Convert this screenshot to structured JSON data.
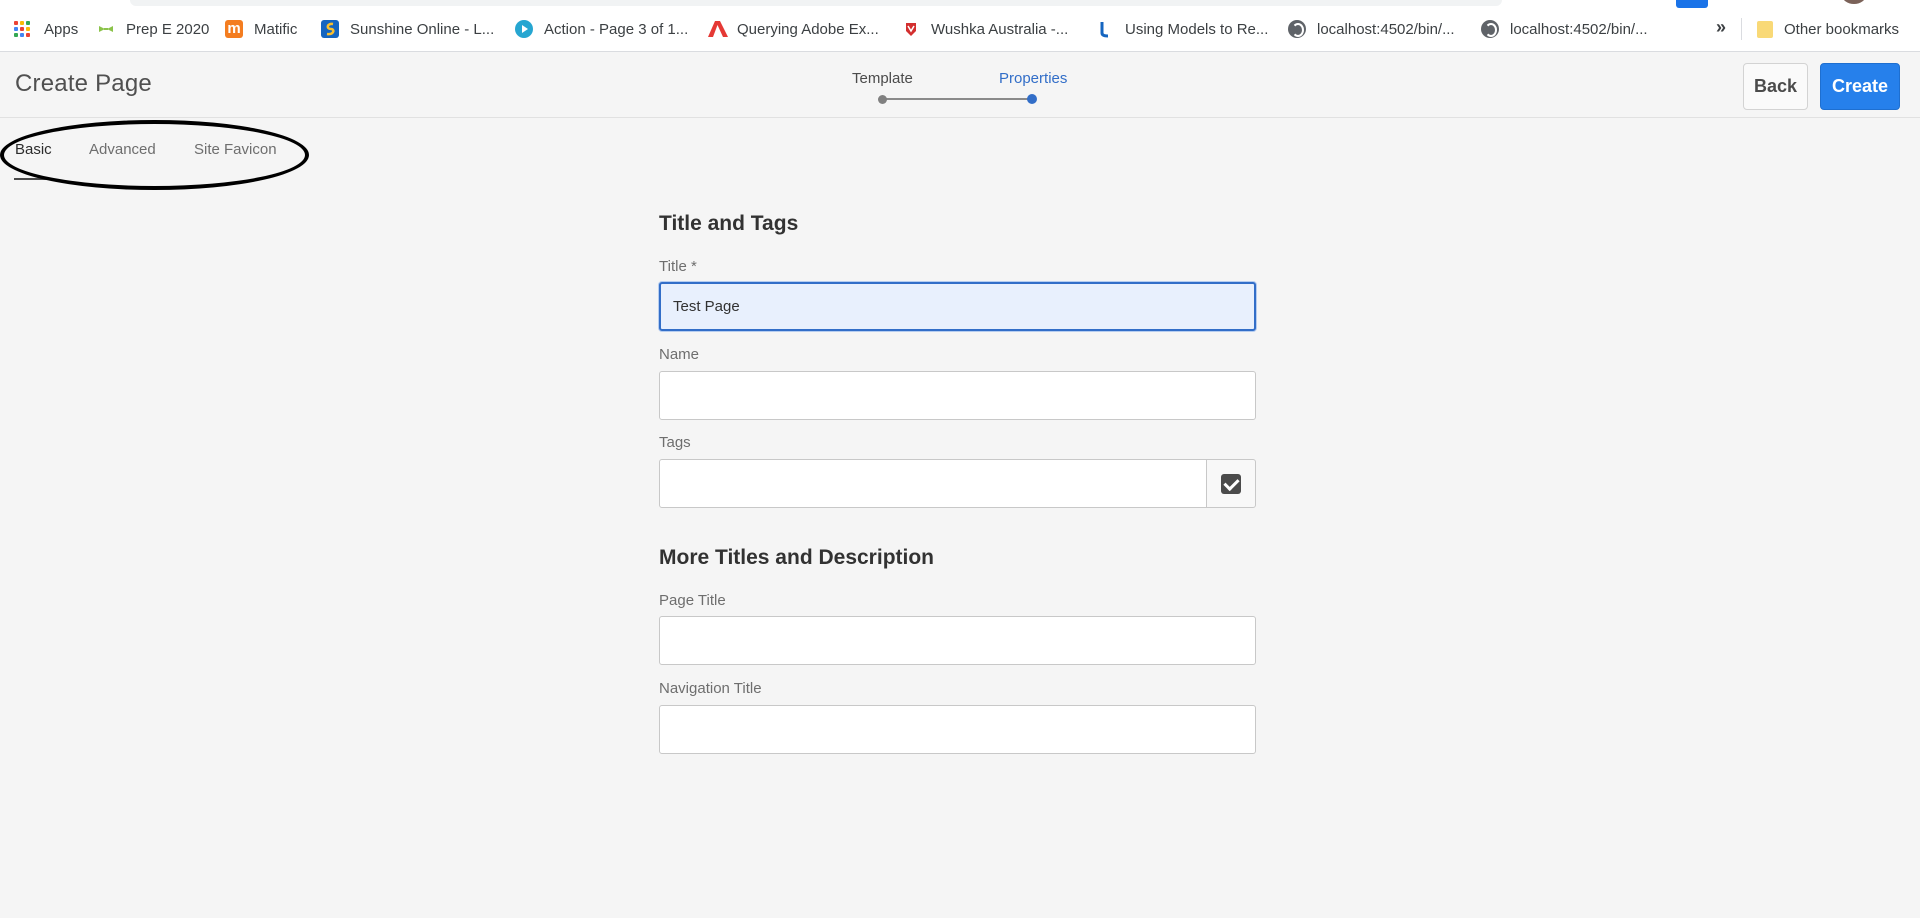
{
  "bookmarks": {
    "items": [
      {
        "label": "Apps",
        "icon": "apps-grid-icon"
      },
      {
        "label": "Prep E 2020",
        "icon": "prep-bookmark-icon",
        "color": "#8bc34a"
      },
      {
        "label": "Matific",
        "icon": "matific-icon",
        "color": "#f47d20"
      },
      {
        "label": "Sunshine Online - L...",
        "icon": "sunshine-online-icon",
        "color": "#1565c0"
      },
      {
        "label": "Action - Page 3 of 1...",
        "icon": "action-play-icon",
        "color": "#26a6d1"
      },
      {
        "label": "Querying Adobe Ex...",
        "icon": "adobe-icon",
        "color": "#e53935"
      },
      {
        "label": "Wushka Australia -...",
        "icon": "wushka-icon",
        "color": "#d32f2f"
      },
      {
        "label": "Using Models to Re...",
        "icon": "using-models-icon",
        "color": "#1565c0"
      },
      {
        "label": "localhost:4502/bin/...",
        "icon": "globe-icon"
      },
      {
        "label": "localhost:4502/bin/...",
        "icon": "globe-icon"
      }
    ],
    "more_label": "»",
    "other_label": "Other bookmarks"
  },
  "header": {
    "title": "Create Page",
    "steps": [
      {
        "label": "Template",
        "active": false
      },
      {
        "label": "Properties",
        "active": true
      }
    ],
    "back_label": "Back",
    "create_label": "Create"
  },
  "tabs": [
    {
      "label": "Basic",
      "active": true
    },
    {
      "label": "Advanced",
      "active": false
    },
    {
      "label": "Site Favicon",
      "active": false
    }
  ],
  "form": {
    "section1_heading": "Title and Tags",
    "title_label": "Title *",
    "title_value": "Test Page",
    "name_label": "Name",
    "name_value": "",
    "tags_label": "Tags",
    "tags_value": "",
    "section2_heading": "More Titles and Description",
    "page_title_label": "Page Title",
    "page_title_value": "",
    "nav_title_label": "Navigation Title",
    "nav_title_value": ""
  },
  "colors": {
    "accent": "#326ec8",
    "primary_button": "#2680eb",
    "background": "#f5f5f5"
  }
}
